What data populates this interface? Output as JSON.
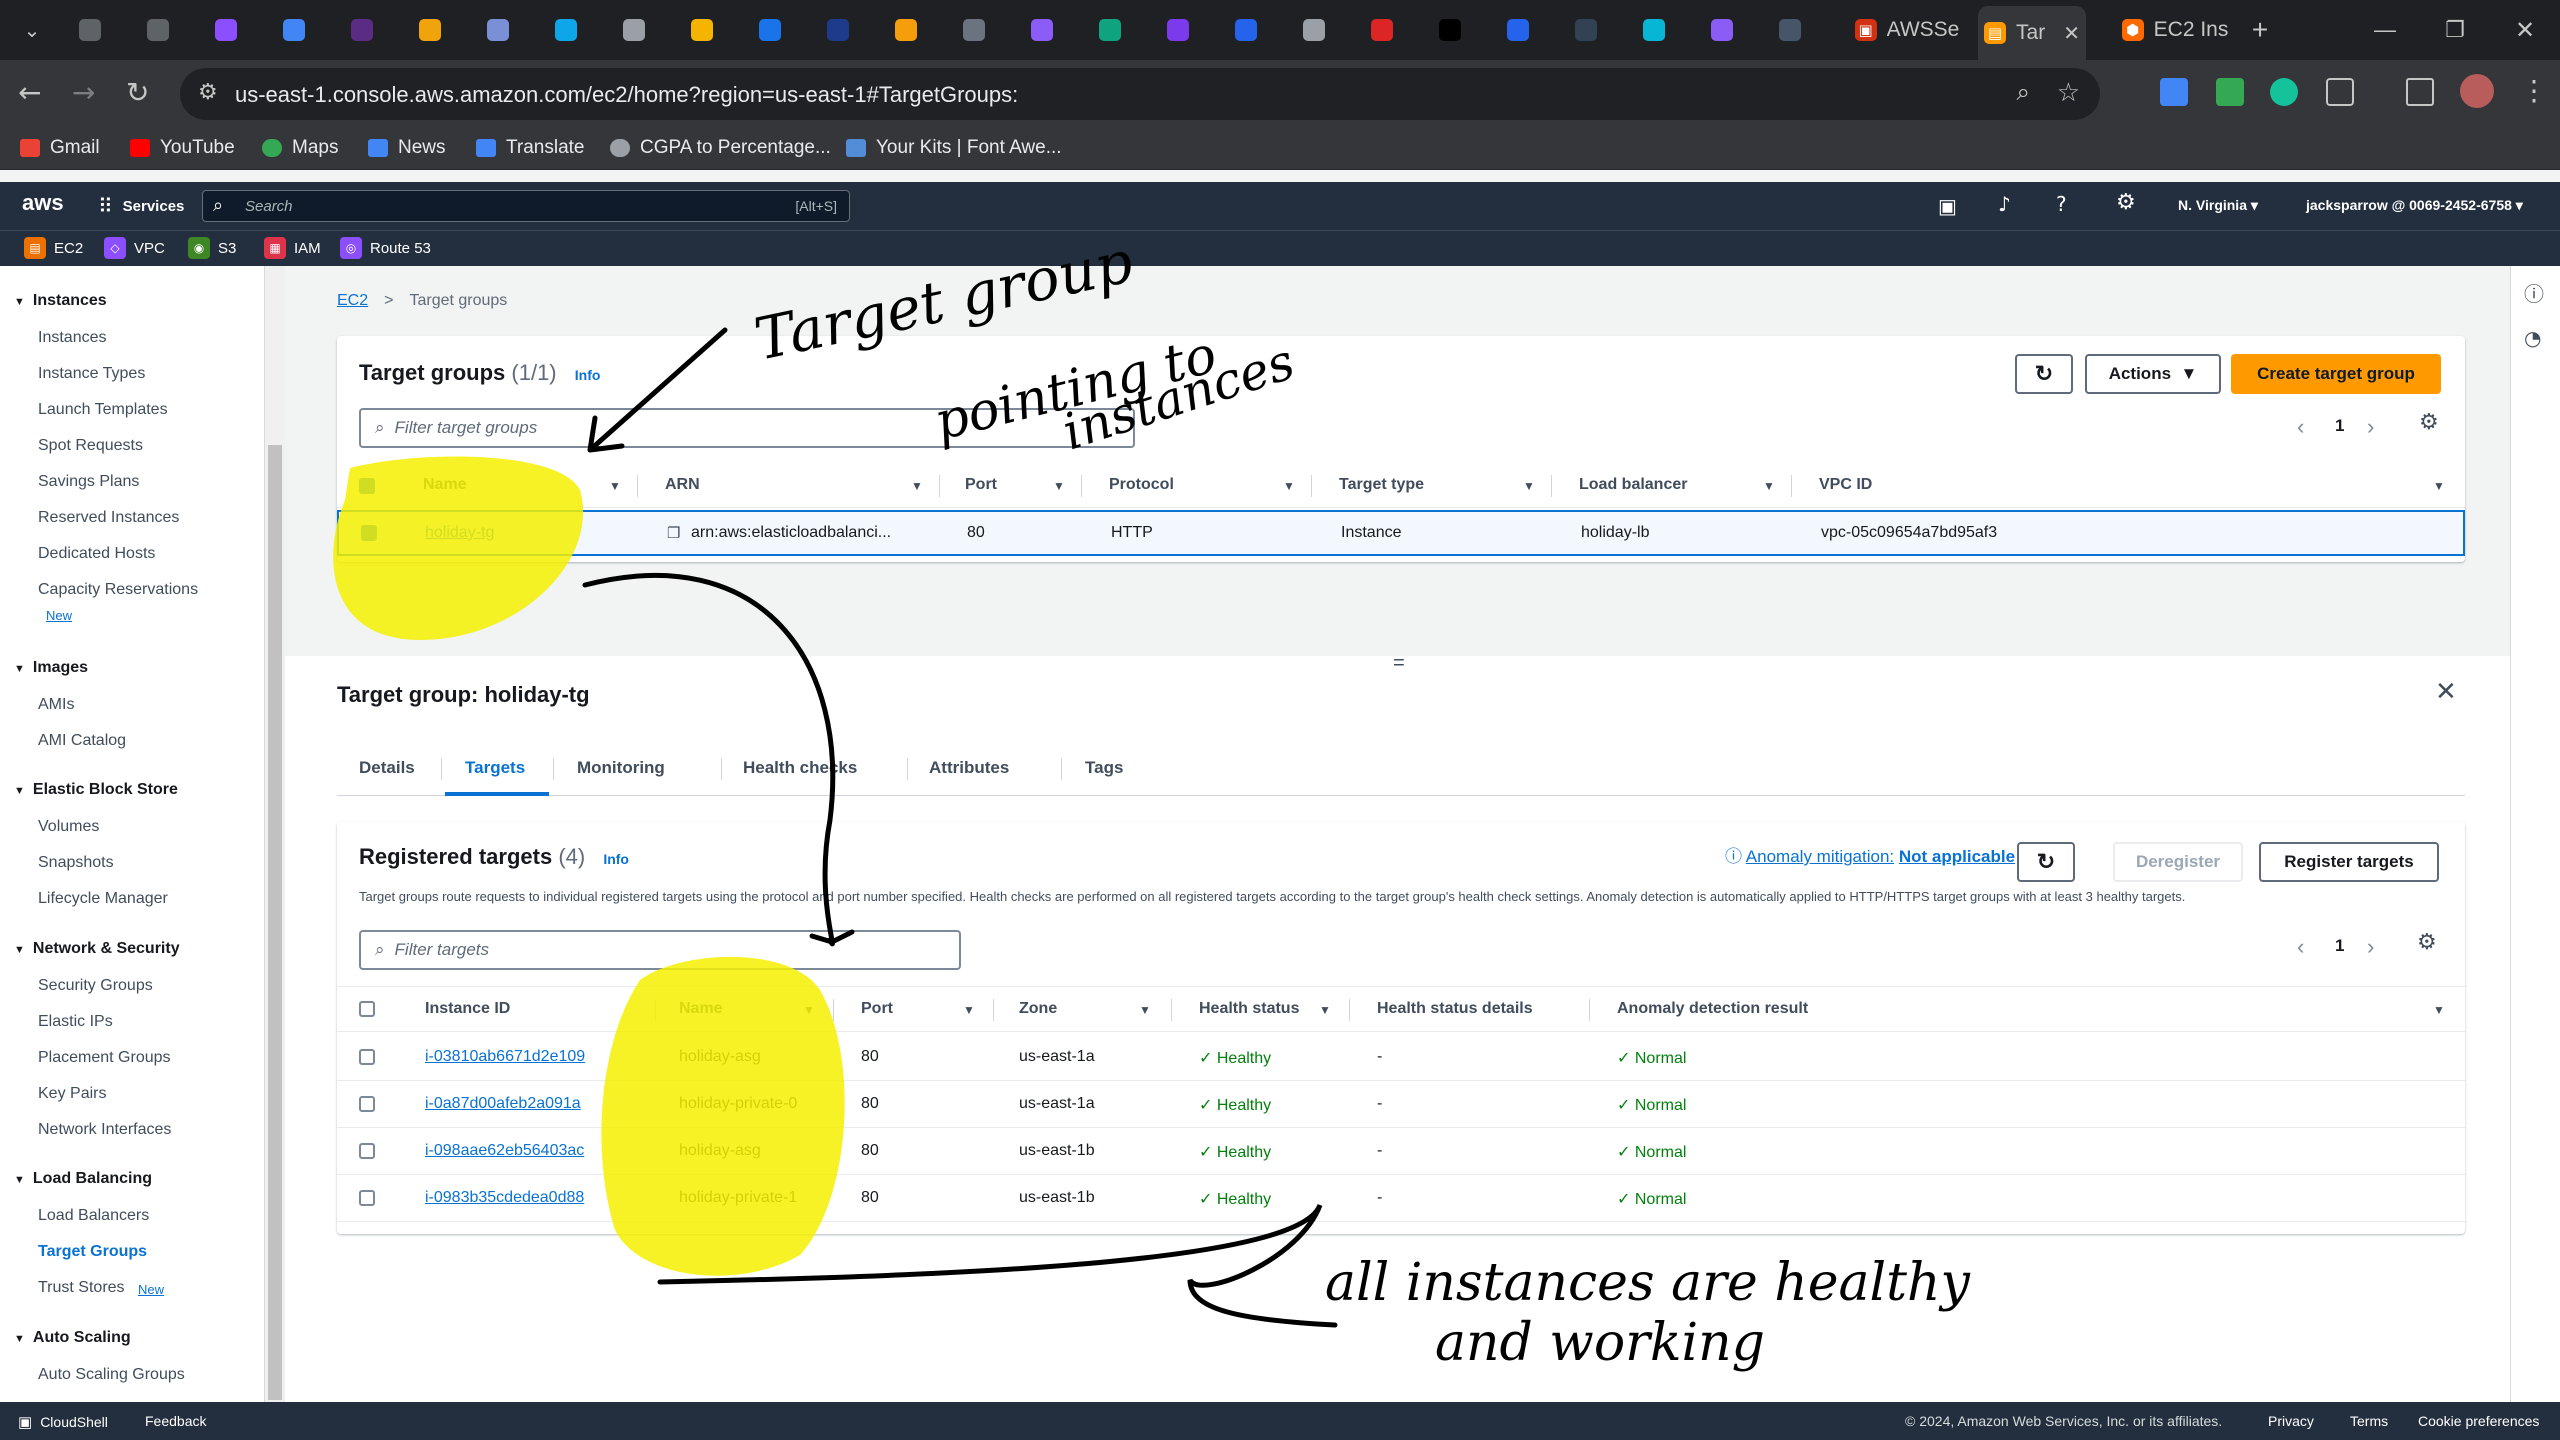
{
  "browser": {
    "tabs": [
      {
        "label": "AWSSe",
        "color": "#d13212"
      },
      {
        "label": "Tar",
        "color": "#ff9900",
        "active": true
      },
      {
        "label": "EC2 Ins",
        "color": "#ff6a00"
      }
    ],
    "url": "us-east-1.console.aws.amazon.com/ec2/home?region=us-east-1#TargetGroups:",
    "bookmarks": [
      {
        "label": "Gmail",
        "color": "#ea4335"
      },
      {
        "label": "YouTube",
        "color": "#ff0000"
      },
      {
        "label": "Maps",
        "color": "#34a853"
      },
      {
        "label": "News",
        "color": "#4285f4"
      },
      {
        "label": "Translate",
        "color": "#4285f4"
      },
      {
        "label": "CGPA to Percentage...",
        "color": "#9aa0a6"
      },
      {
        "label": "Your Kits | Font Awe...",
        "color": "#538dd7"
      }
    ]
  },
  "aws": {
    "logo": "aws",
    "services_label": "Services",
    "search_placeholder": "Search",
    "search_shortcut": "[Alt+S]",
    "region": "N. Virginia",
    "account": "jacksparrow @ 0069-2452-6758",
    "shortcuts": [
      {
        "label": "EC2",
        "color": "#ed7100"
      },
      {
        "label": "VPC",
        "color": "#8c4fff"
      },
      {
        "label": "S3",
        "color": "#3f8624"
      },
      {
        "label": "IAM",
        "color": "#dd344c"
      },
      {
        "label": "Route 53",
        "color": "#8c4fff"
      }
    ]
  },
  "sidebar": {
    "sections": [
      {
        "title": "Instances",
        "items": [
          "Instances",
          "Instance Types",
          "Launch Templates",
          "Spot Requests",
          "Savings Plans",
          "Reserved Instances",
          "Dedicated Hosts",
          "Capacity Reservations"
        ]
      },
      {
        "title": "Images",
        "items": [
          "AMIs",
          "AMI Catalog"
        ]
      },
      {
        "title": "Elastic Block Store",
        "items": [
          "Volumes",
          "Snapshots",
          "Lifecycle Manager"
        ]
      },
      {
        "title": "Network & Security",
        "items": [
          "Security Groups",
          "Elastic IPs",
          "Placement Groups",
          "Key Pairs",
          "Network Interfaces"
        ]
      },
      {
        "title": "Load Balancing",
        "items": [
          "Load Balancers",
          "Target Groups",
          "Trust Stores"
        ]
      },
      {
        "title": "Auto Scaling",
        "items": [
          "Auto Scaling Groups"
        ]
      }
    ],
    "new_label": "New"
  },
  "breadcrumb": {
    "root": "EC2",
    "current": "Target groups"
  },
  "target_groups": {
    "title": "Target groups",
    "count": "(1/1)",
    "info": "Info",
    "filter_placeholder": "Filter target groups",
    "actions_label": "Actions",
    "create_label": "Create target group",
    "page": "1",
    "columns": [
      "Name",
      "ARN",
      "Port",
      "Protocol",
      "Target type",
      "Load balancer",
      "VPC ID"
    ],
    "rows": [
      {
        "name": "holiday-tg",
        "arn": "arn:aws:elasticloadbalanci...",
        "port": "80",
        "protocol": "HTTP",
        "target_type": "Instance",
        "load_balancer": "holiday-lb",
        "vpc_id": "vpc-05c09654a7bd95af3"
      }
    ]
  },
  "detail": {
    "title": "Target group: holiday-tg",
    "tabs": [
      "Details",
      "Targets",
      "Monitoring",
      "Health checks",
      "Attributes",
      "Tags"
    ],
    "active_tab": "Targets"
  },
  "registered": {
    "title": "Registered targets",
    "count": "(4)",
    "info": "Info",
    "anomaly_label": "Anomaly mitigation:",
    "anomaly_value": "Not applicable",
    "deregister_label": "Deregister",
    "register_label": "Register targets",
    "description": "Target groups route requests to individual registered targets using the protocol and port number specified. Health checks are performed on all registered targets according to the target group's health check settings. Anomaly detection is automatically applied to HTTP/HTTPS target groups with at least 3 healthy targets.",
    "filter_placeholder": "Filter targets",
    "page": "1",
    "columns": [
      "Instance ID",
      "Name",
      "Port",
      "Zone",
      "Health status",
      "Health status details",
      "Anomaly detection result"
    ],
    "rows": [
      {
        "id": "i-03810ab6671d2e109",
        "name": "holiday-asg",
        "port": "80",
        "zone": "us-east-1a",
        "health": "Healthy",
        "details": "-",
        "anomaly": "Normal"
      },
      {
        "id": "i-0a87d00afeb2a091a",
        "name": "holiday-private-0",
        "port": "80",
        "zone": "us-east-1a",
        "health": "Healthy",
        "details": "-",
        "anomaly": "Normal"
      },
      {
        "id": "i-098aae62eb56403ac",
        "name": "holiday-asg",
        "port": "80",
        "zone": "us-east-1b",
        "health": "Healthy",
        "details": "-",
        "anomaly": "Normal"
      },
      {
        "id": "i-0983b35cdedea0d88",
        "name": "holiday-private-1",
        "port": "80",
        "zone": "us-east-1b",
        "health": "Healthy",
        "details": "-",
        "anomaly": "Normal"
      }
    ]
  },
  "annotations": {
    "top": [
      "Target group",
      "pointing to",
      "instances"
    ],
    "bottom": [
      "all instances are healthy",
      "and working"
    ]
  },
  "footer": {
    "cloudshell": "CloudShell",
    "feedback": "Feedback",
    "copyright": "© 2024, Amazon Web Services, Inc. or its affiliates.",
    "privacy": "Privacy",
    "terms": "Terms",
    "cookies": "Cookie preferences"
  },
  "colors": {
    "accent": "#0972d3",
    "primary_button": "#ff9900",
    "healthy": "#037f0c",
    "highlight": "#f5f000"
  }
}
